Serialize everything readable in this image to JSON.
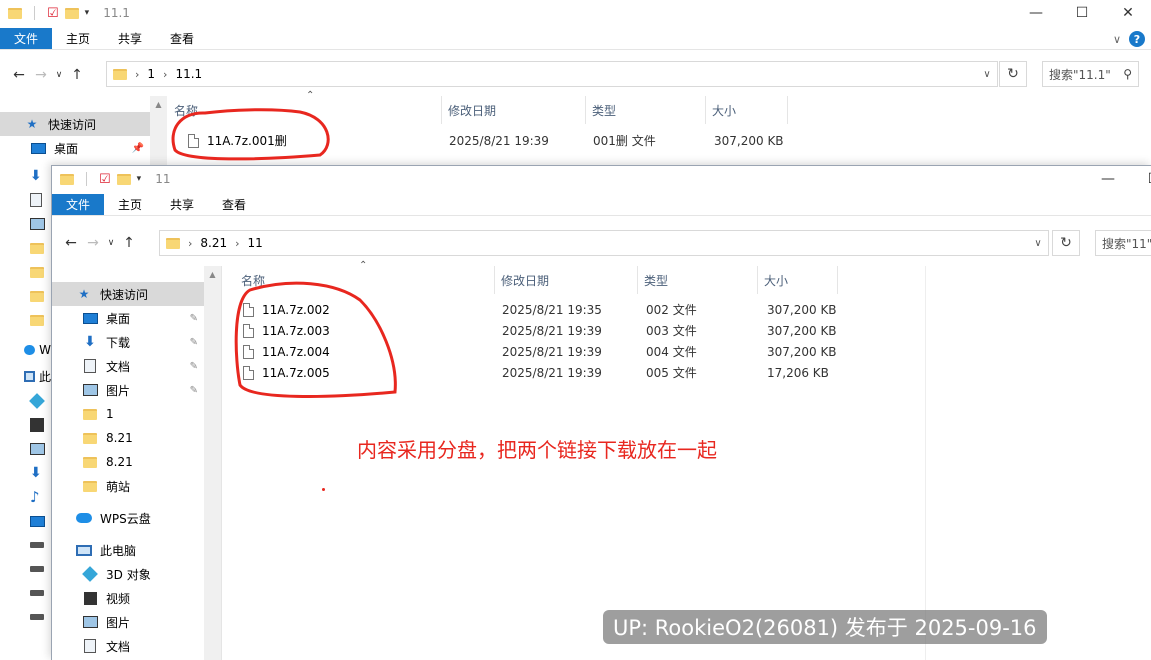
{
  "back_window": {
    "title": "11.1",
    "ribbon_tabs": [
      "文件",
      "主页",
      "共享",
      "查看"
    ],
    "breadcrumb": [
      "1",
      "11.1"
    ],
    "search_placeholder": "搜索\"11.1\"",
    "columns": [
      "名称",
      "修改日期",
      "类型",
      "大小"
    ],
    "files": [
      {
        "name": "11A.7z.001删",
        "date": "2025/8/21 19:39",
        "type": "001删 文件",
        "size": "307,200 KB"
      }
    ],
    "nav": {
      "quick_access": "快速访问",
      "desktop": "桌面"
    }
  },
  "front_window": {
    "title": "11",
    "ribbon_tabs": [
      "文件",
      "主页",
      "共享",
      "查看"
    ],
    "breadcrumb": [
      "8.21",
      "11"
    ],
    "search_placeholder": "搜索\"11\"",
    "columns": [
      "名称",
      "修改日期",
      "类型",
      "大小"
    ],
    "files": [
      {
        "name": "11A.7z.002",
        "date": "2025/8/21 19:35",
        "type": "002 文件",
        "size": "307,200 KB"
      },
      {
        "name": "11A.7z.003",
        "date": "2025/8/21 19:39",
        "type": "003 文件",
        "size": "307,200 KB"
      },
      {
        "name": "11A.7z.004",
        "date": "2025/8/21 19:39",
        "type": "004 文件",
        "size": "307,200 KB"
      },
      {
        "name": "11A.7z.005",
        "date": "2025/8/21 19:39",
        "type": "005 文件",
        "size": "17,206 KB"
      }
    ],
    "nav": {
      "quick_access": "快速访问",
      "items": [
        {
          "label": "桌面",
          "icon": "desktop-icon",
          "pinned": true
        },
        {
          "label": "下载",
          "icon": "download-icon",
          "pinned": true
        },
        {
          "label": "文档",
          "icon": "documents-icon",
          "pinned": true
        },
        {
          "label": "图片",
          "icon": "pictures-icon",
          "pinned": true
        },
        {
          "label": "1",
          "icon": "folder-icon",
          "pinned": false
        },
        {
          "label": "8.21",
          "icon": "folder-icon",
          "pinned": false
        },
        {
          "label": "8.21",
          "icon": "folder-icon",
          "pinned": false
        },
        {
          "label": "萌站",
          "icon": "folder-icon",
          "pinned": false
        }
      ],
      "wps_cloud": "WPS云盘",
      "this_pc": "此电脑",
      "pc_items": [
        {
          "label": "3D 对象",
          "icon": "3d-objects-icon"
        },
        {
          "label": "视频",
          "icon": "video-icon"
        },
        {
          "label": "图片",
          "icon": "pictures-icon"
        },
        {
          "label": "文档",
          "icon": "documents-icon"
        }
      ]
    }
  },
  "annotation_text": "内容采用分盘，把两个链接下载放在一起",
  "watermark": "UP: RookieO2(26081) 发布于 2025-09-16",
  "colors": {
    "accent": "#1979ca",
    "annotation_red": "#e8271f",
    "header_text": "#4c607a"
  }
}
